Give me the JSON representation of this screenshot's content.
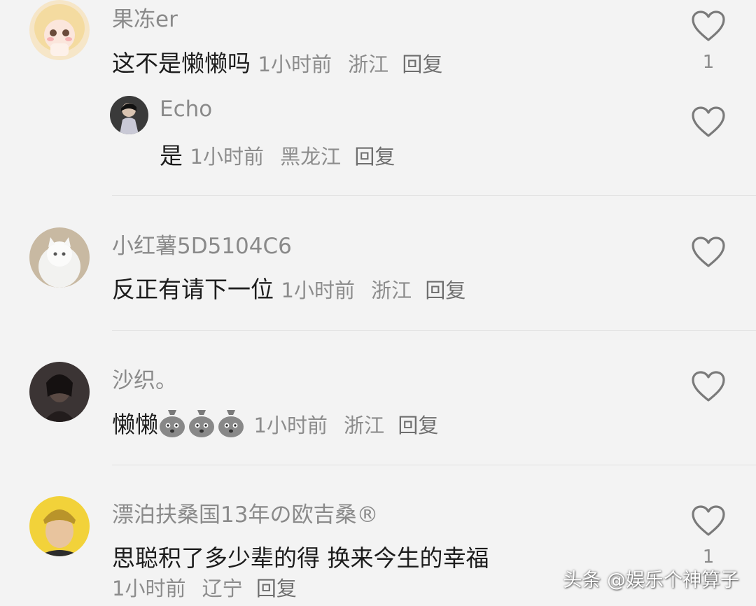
{
  "comments": [
    {
      "username": "果冻er",
      "text": "这不是懒懒吗",
      "time": "1小时前",
      "location": "浙江",
      "reply": "回复",
      "likes": "1",
      "avatar_icon": "anime-girl-avatar"
    },
    {
      "username": "Echo",
      "text": "是",
      "time": "1小时前",
      "location": "黑龙江",
      "reply": "回复",
      "likes": "",
      "avatar_icon": "person-photo-avatar"
    },
    {
      "username": "小红薯5D5104C6",
      "text": "反正有请下一位",
      "time": "1小时前",
      "location": "浙江",
      "reply": "回复",
      "likes": "",
      "avatar_icon": "white-cat-avatar"
    },
    {
      "username": "沙织。",
      "text": "懒懒",
      "emoji_count": 3,
      "emoji_icon": "money-bag-face-emoji",
      "time": "1小时前",
      "location": "浙江",
      "reply": "回复",
      "likes": "",
      "avatar_icon": "dark-portrait-avatar"
    },
    {
      "username": "漂泊扶桑国13年の欧吉桑®",
      "text": "思聪积了多少辈的得 换来今生的幸福",
      "time": "1小时前",
      "location": "辽宁",
      "reply": "回复",
      "likes": "1",
      "avatar_icon": "man-yellow-bg-avatar"
    }
  ],
  "watermark": "头条 @娱乐个神算子",
  "colors": {
    "background": "#f3f3f3",
    "username": "#8a8a8a",
    "meta": "#8c8c8c",
    "heart_stroke": "#7a7a7a"
  }
}
